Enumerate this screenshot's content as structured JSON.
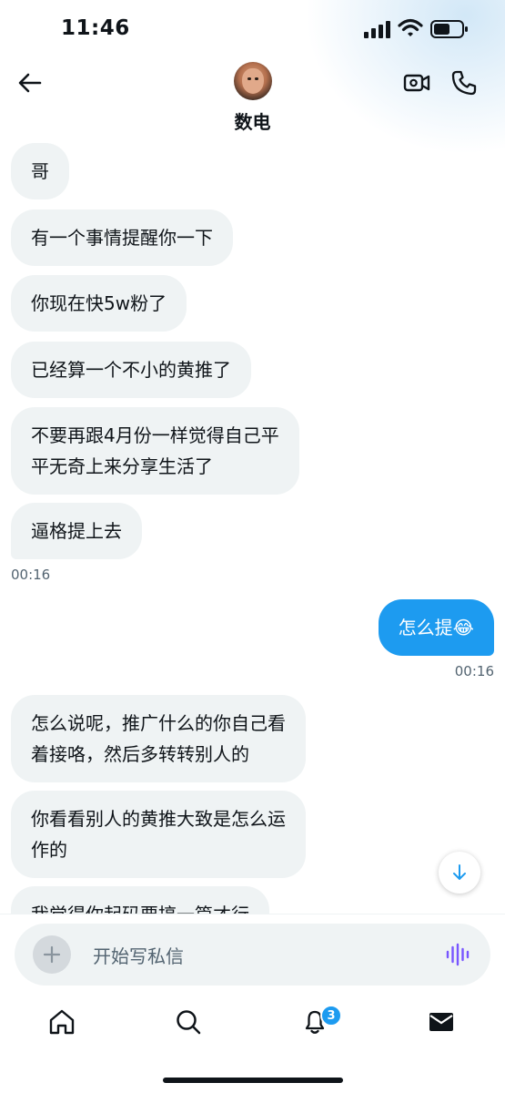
{
  "status_bar": {
    "time": "11:46"
  },
  "header": {
    "contact_name": "数电"
  },
  "messages": [
    {
      "side": "in",
      "text": "哥"
    },
    {
      "side": "in",
      "text": "有一个事情提醒你一下"
    },
    {
      "side": "in",
      "text": "你现在快5w粉了"
    },
    {
      "side": "in",
      "text": "已经算一个不小的黄推了"
    },
    {
      "side": "in",
      "lines": [
        "不要再跟4月份一样觉得自己平",
        "平无奇上来分享生活了"
      ]
    },
    {
      "side": "in",
      "text": "逼格提上去"
    },
    {
      "side": "in",
      "text": "00:16"
    },
    {
      "side": "out",
      "text": "怎么提😂"
    },
    {
      "side": "out",
      "text": "00:16"
    },
    {
      "side": "in",
      "lines": [
        "怎么说呢，推广什么的你自己看",
        "着接咯，然后多转转别人的"
      ]
    },
    {
      "side": "in",
      "lines": [
        "你看看别人的黄推大致是怎么运",
        "作的"
      ]
    },
    {
      "side": "in",
      "text": "我觉得你起码要搞一篇才行"
    }
  ],
  "composer": {
    "placeholder": "开始写私信"
  },
  "tabbar": {
    "notifications_badge": "3"
  }
}
